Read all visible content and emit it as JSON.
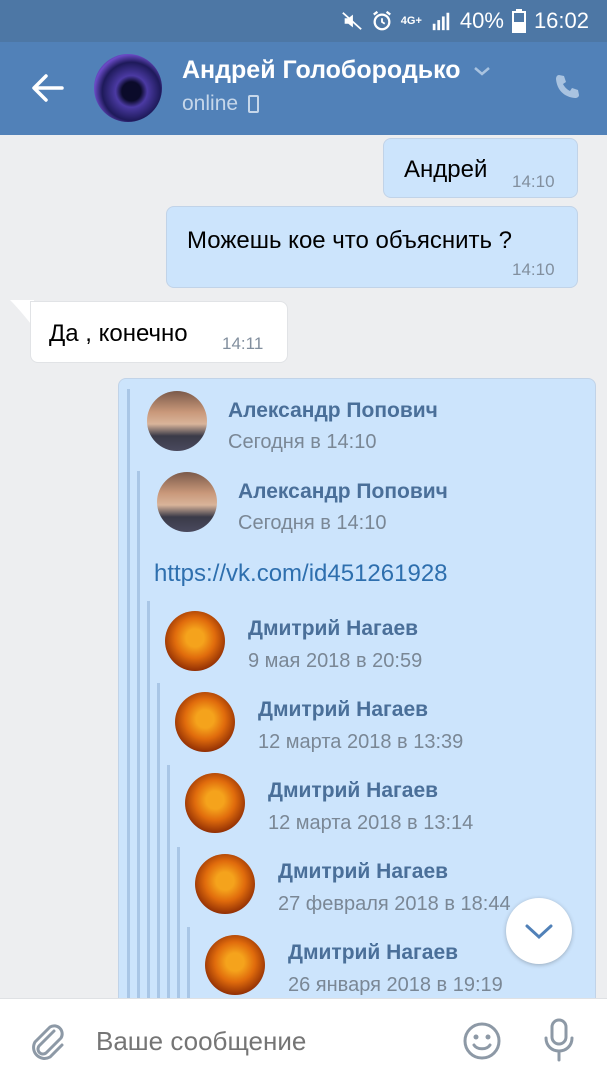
{
  "status_bar": {
    "network": "4G+",
    "battery": "40%",
    "time": "16:02",
    "icons": [
      "mute-icon",
      "alarm-icon",
      "signal-icon",
      "battery-icon"
    ]
  },
  "header": {
    "name": "Андрей Голобородько",
    "status": "online"
  },
  "messages": [
    {
      "dir": "out",
      "text": "Андрей",
      "time": "14:10"
    },
    {
      "dir": "out",
      "text": "Можешь кое что объяснить ?",
      "time": "14:10"
    },
    {
      "dir": "in",
      "text": "Да , конечно",
      "time": "14:11"
    }
  ],
  "forwarded": [
    {
      "name": "Александр Попович",
      "date": "Сегодня в 14:10",
      "avatar": "person"
    },
    {
      "name": "Александр Попович",
      "date": "Сегодня в 14:10",
      "avatar": "person"
    },
    {
      "link": "https://vk.com/id451261928"
    },
    {
      "name": "Дмитрий Нагаев",
      "date": "9 мая 2018 в 20:59",
      "avatar": "pumpkin"
    },
    {
      "name": "Дмитрий Нагаев",
      "date": "12 марта 2018 в 13:39",
      "avatar": "pumpkin"
    },
    {
      "name": "Дмитрий Нагаев",
      "date": "12 марта 2018 в 13:14",
      "avatar": "pumpkin"
    },
    {
      "name": "Дмитрий Нагаев",
      "date": "27 февраля 2018 в 18:44",
      "avatar": "pumpkin"
    },
    {
      "name": "Дмитрий Нагаев",
      "date": "26 января 2018 в 19:19",
      "avatar": "pumpkin"
    }
  ],
  "composer": {
    "placeholder": "Ваше сообщение"
  },
  "colors": {
    "header": "#5181b8",
    "status_bar": "#4d77a5",
    "outgoing": "#cce4fc",
    "incoming": "#ffffff",
    "name": "#4a6f99",
    "link": "#2e6fae"
  }
}
